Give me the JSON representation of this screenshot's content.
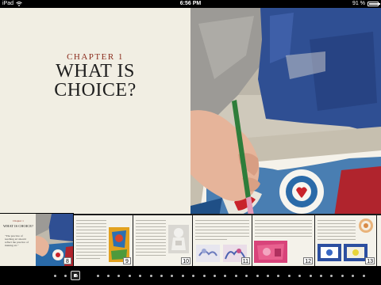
{
  "status_bar": {
    "device": "iPad",
    "time": "6:56 PM",
    "battery_text": "91 %",
    "battery_level": 0.91,
    "wifi_icon": "wifi-icon"
  },
  "page": {
    "chapter_label": "CHAPTER 1",
    "chapter_title": "WHAT IS\nCHOICE?"
  },
  "scrubber": {
    "current_thumb": {
      "chapter": "Chapter 1",
      "title": "WHAT IS CHOICE?",
      "quote": "\"The practice of teaching art should reflect the practice of making art.\"",
      "page_number": "8"
    },
    "thumbs": [
      {
        "page_number": "9"
      },
      {
        "page_number": "10"
      },
      {
        "page_number": "11"
      },
      {
        "page_number": "12"
      },
      {
        "page_number": "13"
      }
    ]
  },
  "page_dots": {
    "current_index": 3,
    "count": 30
  }
}
